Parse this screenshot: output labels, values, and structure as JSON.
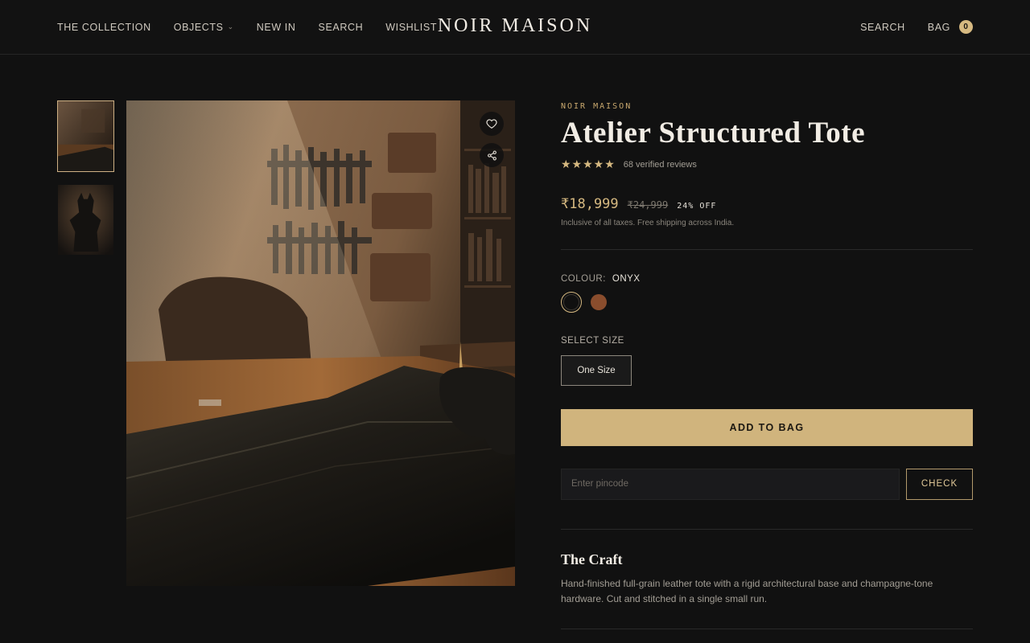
{
  "brand": "NOIR MAISON",
  "nav": {
    "collection": "THE COLLECTION",
    "objects": "OBJECTS",
    "new_in": "NEW IN",
    "search": "SEARCH",
    "wishlist": "WISHLIST",
    "search_right": "SEARCH",
    "bag": "BAG",
    "bag_count": "0"
  },
  "product": {
    "maison": "NOIR MAISON",
    "title": "Atelier Structured Tote",
    "rating_stars": 5,
    "reviews": "68 verified reviews",
    "price": "₹18,999",
    "mrp": "₹24,999",
    "discount": "24% OFF",
    "taxes_note": "Inclusive of all taxes. Free shipping across India.",
    "colour_label": "COLOUR:",
    "colour_value": "ONYX",
    "swatches": [
      "#101010",
      "#8a4d2d"
    ],
    "size_label": "SELECT SIZE",
    "size_option": "One Size",
    "add_to_bag": "ADD TO BAG",
    "pincode_placeholder": "Enter pincode",
    "check": "CHECK",
    "craft_title": "The Craft",
    "craft_text": "Hand-finished full-grain leather tote with a rigid architectural base and champagne-tone hardware. Cut and stitched in a single small run."
  },
  "colors": {
    "accent": "#d0b47d",
    "background": "#111111"
  }
}
